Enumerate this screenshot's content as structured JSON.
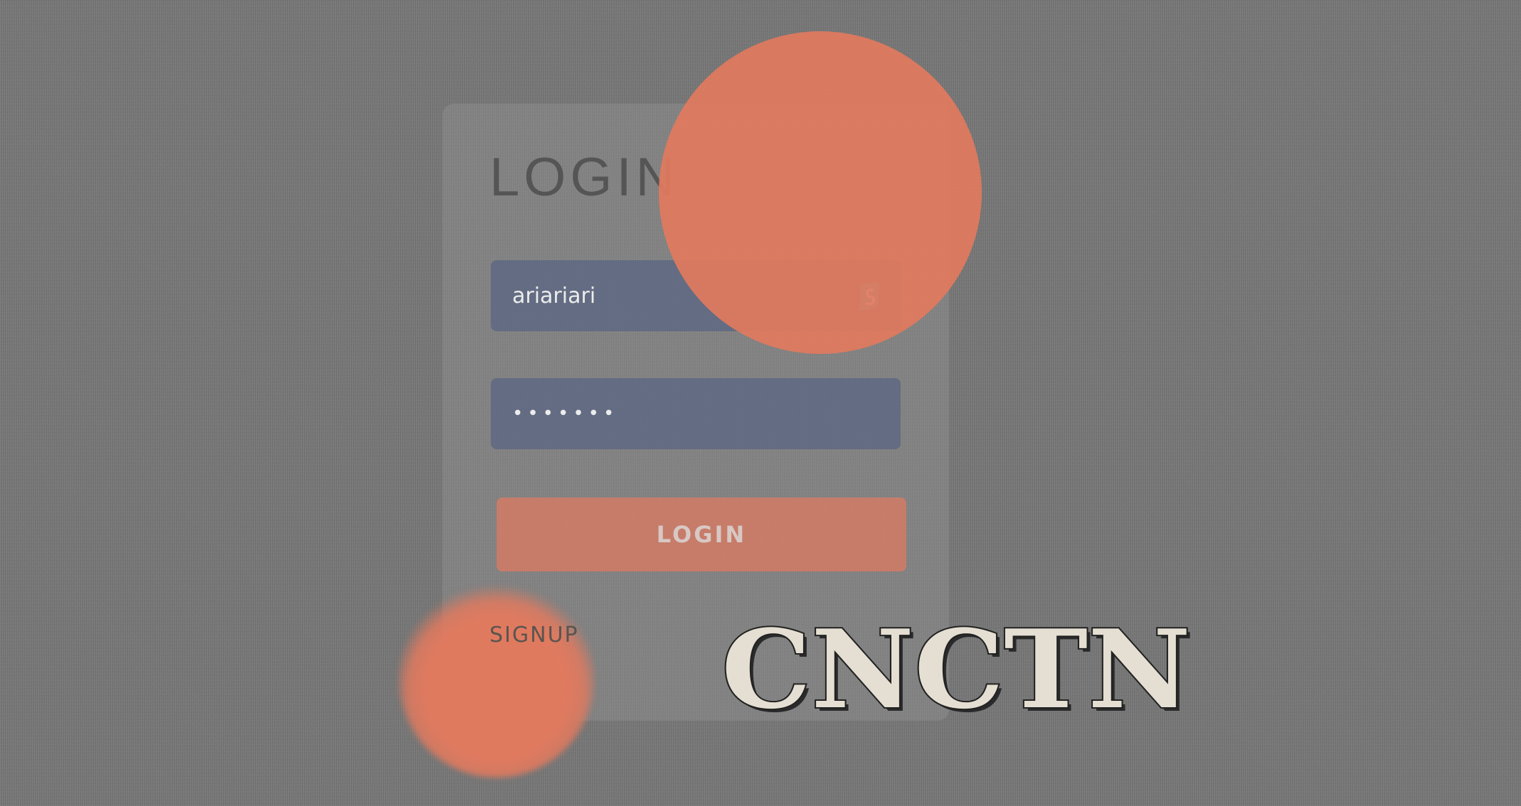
{
  "login_form": {
    "title": "LOGIN",
    "username": {
      "value": "ariariari",
      "extension_icon": "surfshark-icon"
    },
    "password": {
      "value": "•••••••"
    },
    "submit_label": "LOGIN",
    "signup_label": "SIGNUP"
  },
  "brand": {
    "wordmark": "CNCTN"
  },
  "colors": {
    "background": "#7a7a7a",
    "accent": "#e07a5f",
    "input_fill": "#586482",
    "title_text": "#555555",
    "wordmark_fill": "#e4dfd2",
    "extension_icon": "#4fb0c6"
  }
}
